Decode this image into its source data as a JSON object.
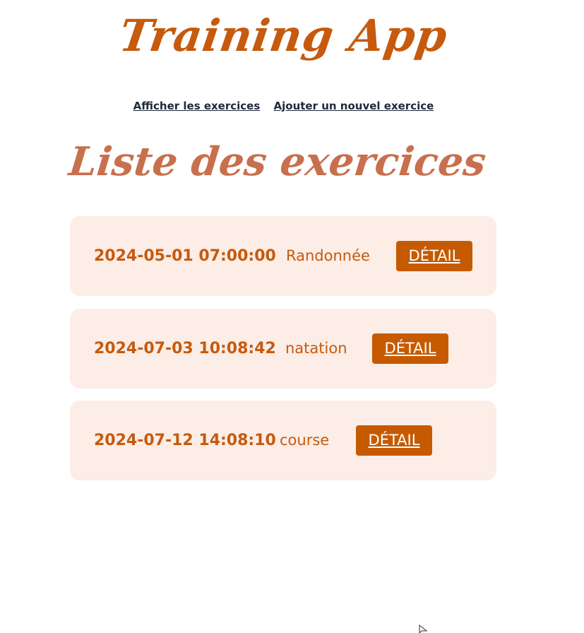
{
  "header": {
    "title": "Training App"
  },
  "nav": {
    "items": [
      {
        "label": "Afficher les exercices"
      },
      {
        "label": "Ajouter un nouvel exercice"
      }
    ]
  },
  "main": {
    "heading": "Liste des exercices",
    "exercises": [
      {
        "datetime": "2024-05-01 07:00:00",
        "type": "Randonnée",
        "button": "DÉTAIL"
      },
      {
        "datetime": "2024-07-03 10:08:42",
        "type": "natation",
        "button": "DÉTAIL"
      },
      {
        "datetime": "2024-07-12 14:08:10",
        "type": "course",
        "button": "DÉTAIL"
      }
    ]
  },
  "colors": {
    "accent": "#c65a0e",
    "heading": "#c8704d",
    "card_background": "#fcede6",
    "button_background": "#c65a00",
    "nav_link": "#1f2a3a"
  },
  "icons": {
    "cursor": "mouse-pointer-icon"
  }
}
